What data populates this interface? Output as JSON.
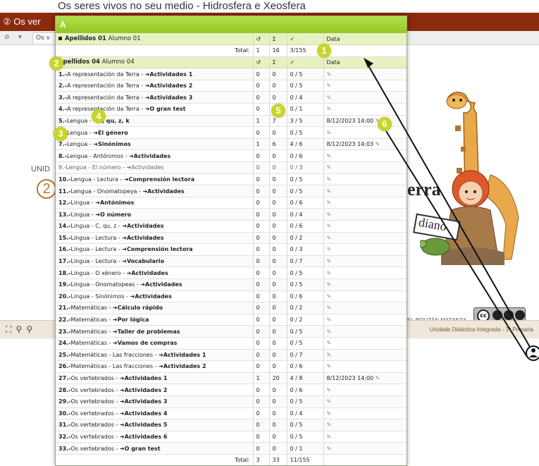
{
  "background": {
    "title_prefix": "② Os ver",
    "top_title": "Os seres vivos no seu medio - Hidrosfera e Xeosfera",
    "tab_label": "Os v",
    "unidade_label": "UNID",
    "unidade_number": "2",
    "cover_word": "erra",
    "cover_subword": "diano",
    "author": "EL BOUZÁN MATANZA",
    "footer_right": "Unidade Didáctica Integrada - 3º Primaria",
    "cc_text": "cc"
  },
  "popup": {
    "header_letter": "A",
    "student1": {
      "surname": "Apellidos 01",
      "name": "Alumno 01",
      "col_attempts": "↺",
      "col_sum": "Σ",
      "col_ok": "✓",
      "col_date": "Data"
    },
    "total1": {
      "label": "Total:",
      "attempts": "1",
      "sum": "16",
      "ok": "3/155"
    },
    "student2": {
      "surname": "Apellidos 04",
      "name": "Alumno 04",
      "col_attempts": "↺",
      "col_sum": "Σ",
      "col_ok": "✓",
      "col_date": "Data"
    },
    "rows": [
      {
        "num": "1.-",
        "subject": "A representación da Terra - ",
        "activity": "➜Actividades 1",
        "attempts": "0",
        "sum": "0",
        "ok": "0 / 5",
        "date": ""
      },
      {
        "num": "2.-",
        "subject": "A representación da Terra - ",
        "activity": "➜Actividades 2",
        "attempts": "0",
        "sum": "0",
        "ok": "0 / 5",
        "date": ""
      },
      {
        "num": "3.-",
        "subject": "A representación da Terra - ",
        "activity": "➜Actividades 3",
        "attempts": "0",
        "sum": "0",
        "ok": "0 / 4",
        "date": ""
      },
      {
        "num": "4.-",
        "subject": "A representación da Terra - ",
        "activity": "➜O gran test",
        "attempts": "0",
        "sum": "0",
        "ok": "0 / 1",
        "date": ""
      },
      {
        "num": "5.-",
        "subject": "Lengua - ",
        "activity": "➜C, qu, z, k",
        "attempts": "1",
        "sum": "7",
        "ok": "3 / 5",
        "date": "8/12/2023 14:00"
      },
      {
        "num": "6.-",
        "subject": "Lengua - ",
        "activity": "➜El género",
        "attempts": "0",
        "sum": "0",
        "ok": "0 / 5",
        "date": ""
      },
      {
        "num": "7.-",
        "subject": "Lengua - ",
        "activity": "➜Sinónimos",
        "attempts": "1",
        "sum": "6",
        "ok": "4 / 6",
        "date": "8/12/2023 14:03"
      },
      {
        "num": "8.-",
        "subject": "Lengua - Antónimos - ",
        "activity": "➜Actividades",
        "attempts": "0",
        "sum": "0",
        "ok": "0 / 6",
        "date": ""
      },
      {
        "num": "9.-",
        "subject": "Lengua - El número - ",
        "activity": "➜Actividades",
        "attempts": "0",
        "sum": "0",
        "ok": "0 / 3",
        "date": "",
        "grey": true
      },
      {
        "num": "10.-",
        "subject": "Lengua - Lectura - ",
        "activity": "➜Comprensión lectora",
        "attempts": "0",
        "sum": "0",
        "ok": "0 / 5",
        "date": ""
      },
      {
        "num": "11.-",
        "subject": "Lengua - Onomatopeya - ",
        "activity": "➜Actividades",
        "attempts": "0",
        "sum": "0",
        "ok": "0 / 5",
        "date": ""
      },
      {
        "num": "12.-",
        "subject": "Lingua - ",
        "activity": "➜Antónimos",
        "attempts": "0",
        "sum": "0",
        "ok": "0 / 6",
        "date": ""
      },
      {
        "num": "13.-",
        "subject": "Lingua - ",
        "activity": "➜O número",
        "attempts": "0",
        "sum": "0",
        "ok": "0 / 4",
        "date": ""
      },
      {
        "num": "14.-",
        "subject": "Lingua - C, qu, z - ",
        "activity": "➜Actividades",
        "attempts": "0",
        "sum": "0",
        "ok": "0 / 6",
        "date": ""
      },
      {
        "num": "15.-",
        "subject": "Lingua - Lectura - ",
        "activity": "➜Actividades",
        "attempts": "0",
        "sum": "0",
        "ok": "0 / 2",
        "date": ""
      },
      {
        "num": "16.-",
        "subject": "Lingua - Lectura - ",
        "activity": "➜Comprensión lectora",
        "attempts": "0",
        "sum": "0",
        "ok": "0 / 3",
        "date": ""
      },
      {
        "num": "17.-",
        "subject": "Lingua - Lectura - ",
        "activity": "➜Vocabulario",
        "attempts": "0",
        "sum": "0",
        "ok": "0 / 7",
        "date": ""
      },
      {
        "num": "18.-",
        "subject": "Lingua - O xénero - ",
        "activity": "➜Actividades",
        "attempts": "0",
        "sum": "0",
        "ok": "0 / 5",
        "date": ""
      },
      {
        "num": "19.-",
        "subject": "Lingua - Onomatopeas - ",
        "activity": "➜Actividades",
        "attempts": "0",
        "sum": "0",
        "ok": "0 / 5",
        "date": ""
      },
      {
        "num": "20.-",
        "subject": "Lingua - Sinónimos - ",
        "activity": "➜Actividades",
        "attempts": "0",
        "sum": "0",
        "ok": "0 / 6",
        "date": ""
      },
      {
        "num": "21.-",
        "subject": "Matemáticas - ",
        "activity": "➜Cálculo rápido",
        "attempts": "0",
        "sum": "0",
        "ok": "0 / 2",
        "date": ""
      },
      {
        "num": "22.-",
        "subject": "Matemáticas - ",
        "activity": "➜Por lógica",
        "attempts": "0",
        "sum": "0",
        "ok": "0 / 2",
        "date": ""
      },
      {
        "num": "23.-",
        "subject": "Matemáticas - ",
        "activity": "➜Taller de problemas",
        "attempts": "0",
        "sum": "0",
        "ok": "0 / 5",
        "date": ""
      },
      {
        "num": "24.-",
        "subject": "Matemáticas - ",
        "activity": "➜Vamos de compras",
        "attempts": "0",
        "sum": "0",
        "ok": "0 / 5",
        "date": ""
      },
      {
        "num": "25.-",
        "subject": "Matemáticas - Las fracciones - ",
        "activity": "➜Actividades 1",
        "attempts": "0",
        "sum": "0",
        "ok": "0 / 7",
        "date": ""
      },
      {
        "num": "26.-",
        "subject": "Matemáticas - Las fracciones - ",
        "activity": "➜Actividades 2",
        "attempts": "0",
        "sum": "0",
        "ok": "0 / 6",
        "date": ""
      },
      {
        "num": "27.-",
        "subject": "Os vertebrados - ",
        "activity": "➜Actividades 1",
        "attempts": "1",
        "sum": "20",
        "ok": "4 / 8",
        "date": "8/12/2023 14:00"
      },
      {
        "num": "28.-",
        "subject": "Os vertebrados - ",
        "activity": "➜Actividades 2",
        "attempts": "0",
        "sum": "0",
        "ok": "0 / 6",
        "date": ""
      },
      {
        "num": "29.-",
        "subject": "Os vertebrados - ",
        "activity": "➜Actividades 3",
        "attempts": "0",
        "sum": "0",
        "ok": "0 / 5",
        "date": ""
      },
      {
        "num": "30.-",
        "subject": "Os vertebrados - ",
        "activity": "➜Actividades 4",
        "attempts": "0",
        "sum": "0",
        "ok": "0 / 4",
        "date": ""
      },
      {
        "num": "31.-",
        "subject": "Os vertebrados - ",
        "activity": "➜Actividades 5",
        "attempts": "0",
        "sum": "0",
        "ok": "0 / 5",
        "date": ""
      },
      {
        "num": "32.-",
        "subject": "Os vertebrados - ",
        "activity": "➜Actividades 6",
        "attempts": "0",
        "sum": "0",
        "ok": "0 / 5",
        "date": ""
      },
      {
        "num": "33.-",
        "subject": "Os vertebrados - ",
        "activity": "➜O gran test",
        "attempts": "0",
        "sum": "0",
        "ok": "0 / 1",
        "date": ""
      }
    ],
    "total2": {
      "label": "Total:",
      "attempts": "3",
      "sum": "33",
      "ok": "11/155"
    },
    "edit_icon": "pencil-icon"
  },
  "annotations": [
    "1",
    "2",
    "3",
    "4",
    "5",
    "6"
  ],
  "colors": {
    "header_green": "#93c627",
    "band_green": "#e7f2c3",
    "badge": "#c9d42a",
    "titlebar": "#8b2a0c"
  }
}
